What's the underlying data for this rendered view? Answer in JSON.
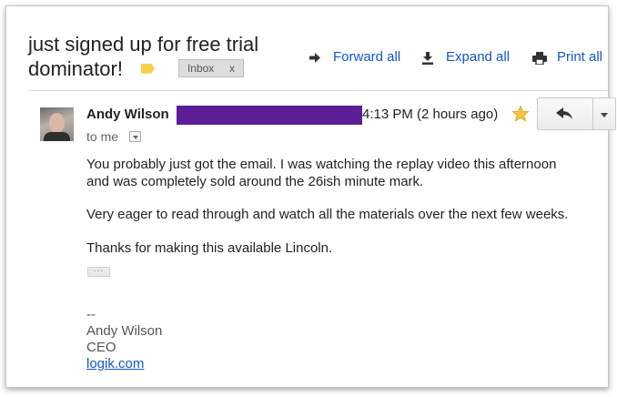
{
  "thread": {
    "subject": "just signed up for free trial dominator!",
    "label_color": "#f7d04c",
    "inbox_label": "Inbox",
    "inbox_close": "x"
  },
  "actions": {
    "forward_all": "Forward all",
    "expand_all": "Expand all",
    "print_all": "Print all",
    "link_color": "#1155cc"
  },
  "message": {
    "sender_name": "Andy Wilson",
    "redaction_color": "#5b1e96",
    "time": "4:13 PM (2 hours ago)",
    "recipient": "to me",
    "paragraphs": [
      "You probably just got the email. I was watching the replay video this afternoon",
      "and was completely sold around the 26ish minute mark.",
      "Very eager to read through and watch all the materials over the next few weeks.",
      "Thanks for making this available Lincoln."
    ],
    "ellipsis": "···",
    "signature": {
      "separator": "--",
      "name": "Andy Wilson",
      "title": "CEO",
      "link": "logik.com"
    }
  },
  "icons": {
    "forward": "forward-arrow-icon",
    "expand": "expand-download-icon",
    "print": "printer-icon",
    "star": "star-icon",
    "reply": "reply-arrow-icon",
    "more": "chevron-down-icon"
  }
}
